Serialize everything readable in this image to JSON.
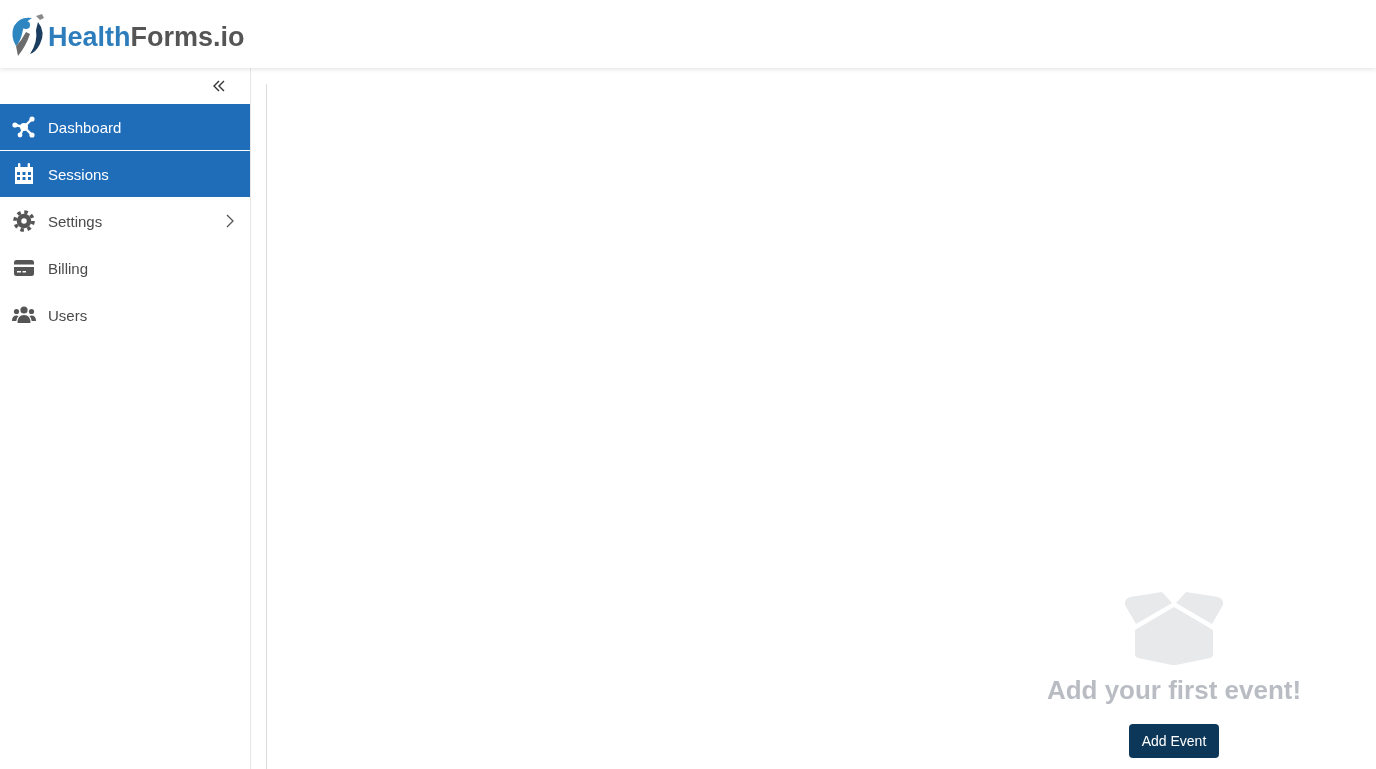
{
  "header": {
    "logo": {
      "text_primary": "Health",
      "text_secondary": "Forms.io"
    }
  },
  "sidebar": {
    "items": [
      {
        "label": "Dashboard",
        "kind": "link",
        "selected": true
      },
      {
        "label": "Sessions",
        "kind": "link",
        "selected": true
      },
      {
        "label": "Settings",
        "kind": "group",
        "selected": false
      },
      {
        "label": "Billing",
        "kind": "link",
        "selected": false
      },
      {
        "label": "Users",
        "kind": "link",
        "selected": false
      }
    ]
  },
  "main": {
    "empty_state": {
      "message": "Add your first event!",
      "button": "Add Event"
    }
  }
}
